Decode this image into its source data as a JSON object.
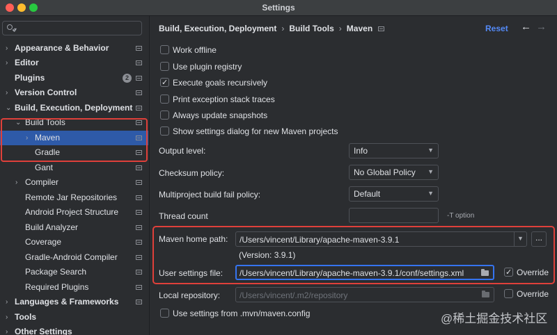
{
  "window": {
    "title": "Settings"
  },
  "search": {
    "placeholder": ""
  },
  "sidebar": {
    "items": [
      {
        "label": "Appearance & Behavior"
      },
      {
        "label": "Editor"
      },
      {
        "label": "Plugins",
        "badge": "2"
      },
      {
        "label": "Version Control"
      },
      {
        "label": "Build, Execution, Deployment"
      },
      {
        "label": "Build Tools"
      },
      {
        "label": "Maven"
      },
      {
        "label": "Gradle"
      },
      {
        "label": "Gant"
      },
      {
        "label": "Compiler"
      },
      {
        "label": "Remote Jar Repositories"
      },
      {
        "label": "Android Project Structure"
      },
      {
        "label": "Build Analyzer"
      },
      {
        "label": "Coverage"
      },
      {
        "label": "Gradle-Android Compiler"
      },
      {
        "label": "Package Search"
      },
      {
        "label": "Required Plugins"
      },
      {
        "label": "Languages & Frameworks"
      },
      {
        "label": "Tools"
      },
      {
        "label": "Other Settings"
      }
    ]
  },
  "header": {
    "breadcrumb": [
      "Build, Execution, Deployment",
      "Build Tools",
      "Maven"
    ],
    "reset_label": "Reset"
  },
  "options": {
    "work_offline": {
      "label": "Work offline",
      "checked": false
    },
    "plugin_registry": {
      "label": "Use plugin registry",
      "checked": false
    },
    "execute_recursively": {
      "label": "Execute goals recursively",
      "checked": true
    },
    "print_stack": {
      "label": "Print exception stack traces",
      "checked": false
    },
    "update_snapshots": {
      "label": "Always update snapshots",
      "checked": false
    },
    "show_dialog": {
      "label": "Show settings dialog for new Maven projects",
      "checked": false
    }
  },
  "fields": {
    "output_level": {
      "label": "Output level:",
      "value": "Info"
    },
    "checksum_policy": {
      "label": "Checksum policy:",
      "value": "No Global Policy"
    },
    "fail_policy": {
      "label": "Multiproject build fail policy:",
      "value": "Default"
    },
    "thread_count": {
      "label": "Thread count",
      "value": "",
      "hint": "-T option"
    },
    "maven_home": {
      "label": "Maven home path:",
      "value": "/Users/vincent/Library/apache-maven-3.9.1",
      "browse": "..."
    },
    "version": "(Version: 3.9.1)",
    "user_settings": {
      "label": "User settings file:",
      "value": "/Users/vincent/Library/apache-maven-3.9.1/conf/settings.xml",
      "override_label": "Override",
      "override_checked": true
    },
    "local_repo": {
      "label": "Local repository:",
      "value": "/Users/vincent/.m2/repository",
      "override_label": "Override",
      "override_checked": false
    },
    "use_mvn_config": {
      "label": "Use settings from .mvn/maven.config",
      "checked": false
    }
  },
  "watermark": "@稀土掘金技术社区",
  "colors": {
    "accent": "#3574f0",
    "selection": "#2e5aa8",
    "highlight_box": "#e0403a"
  }
}
